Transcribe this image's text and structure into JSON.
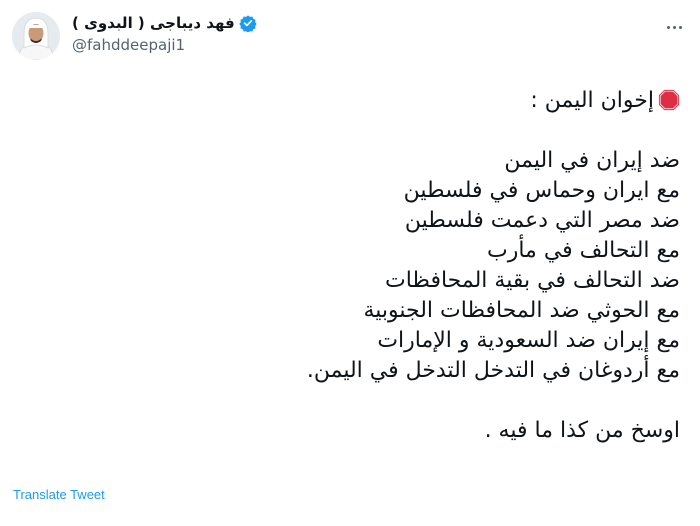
{
  "user": {
    "display_name": "فهد ديباجى ( البدوى )",
    "handle": "@fahddeepaji1",
    "verified_icon": "verified-badge-icon",
    "avatar_icon": "avatar-photo"
  },
  "menu": {
    "icon": "more-options-icon"
  },
  "tweet": {
    "header_icon": "stop-sign-icon",
    "header_text": "إخوان اليمن :",
    "lines": [
      "ضد إيران في اليمن",
      "مع ايران وحماس في فلسطين",
      "ضد مصر التي دعمت فلسطين",
      "مع التحالف في مأرب",
      "ضد التحالف في بقية المحافظات",
      "مع الحوثي ضد المحافظات الجنوبية",
      "مع إيران ضد السعودية و الإمارات",
      "مع أردوغان في التدخل التدخل في اليمن."
    ],
    "closing": "اوسخ من كذا ما فيه ."
  },
  "actions": {
    "translate_label": "Translate Tweet"
  },
  "colors": {
    "accent": "#1d9bf0",
    "text": "#0f1419",
    "secondary": "#536471",
    "stop_red": "#dd2e44"
  }
}
